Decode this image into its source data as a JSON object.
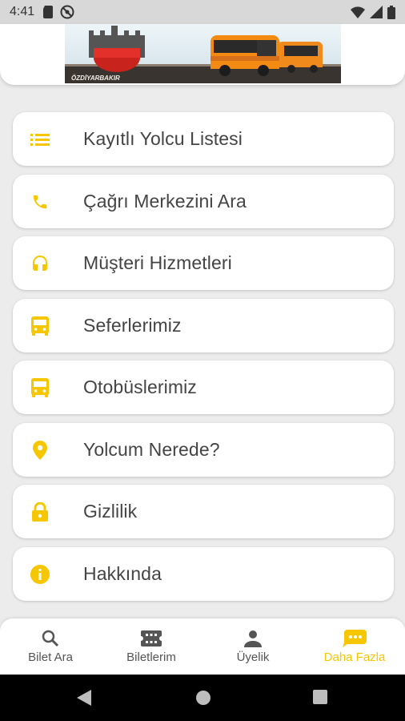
{
  "status_bar": {
    "time": "4:41",
    "left_icons": [
      "sd-card-icon",
      "do-not-disturb-icon"
    ],
    "right_icons": [
      "wifi-icon",
      "signal-icon",
      "battery-icon"
    ]
  },
  "header": {
    "banner_text": "ÖZDİYARBAKIR"
  },
  "colors": {
    "accent": "#f6c700",
    "background": "#ececec",
    "card": "#ffffff",
    "text": "#444444"
  },
  "menu": {
    "items": [
      {
        "label": "Kayıtlı Yolcu Listesi",
        "icon": "list-icon"
      },
      {
        "label": "Çağrı Merkezini Ara",
        "icon": "phone-icon"
      },
      {
        "label": "Müşteri Hizmetleri",
        "icon": "headset-icon"
      },
      {
        "label": "Seferlerimiz",
        "icon": "bus-icon"
      },
      {
        "label": "Otobüslerimiz",
        "icon": "bus-icon"
      },
      {
        "label": "Yolcum Nerede?",
        "icon": "location-pin-icon"
      },
      {
        "label": "Gizlilik",
        "icon": "lock-icon"
      },
      {
        "label": "Hakkında",
        "icon": "info-icon"
      }
    ]
  },
  "bottom_nav": {
    "items": [
      {
        "label": "Bilet Ara",
        "icon": "search-icon",
        "active": false
      },
      {
        "label": "Biletlerim",
        "icon": "ticket-icon",
        "active": false
      },
      {
        "label": "Üyelik",
        "icon": "person-icon",
        "active": false
      },
      {
        "label": "Daha Fazla",
        "icon": "more-chat-icon",
        "active": true
      }
    ]
  },
  "system_nav": [
    "back-icon",
    "home-icon",
    "recents-icon"
  ]
}
